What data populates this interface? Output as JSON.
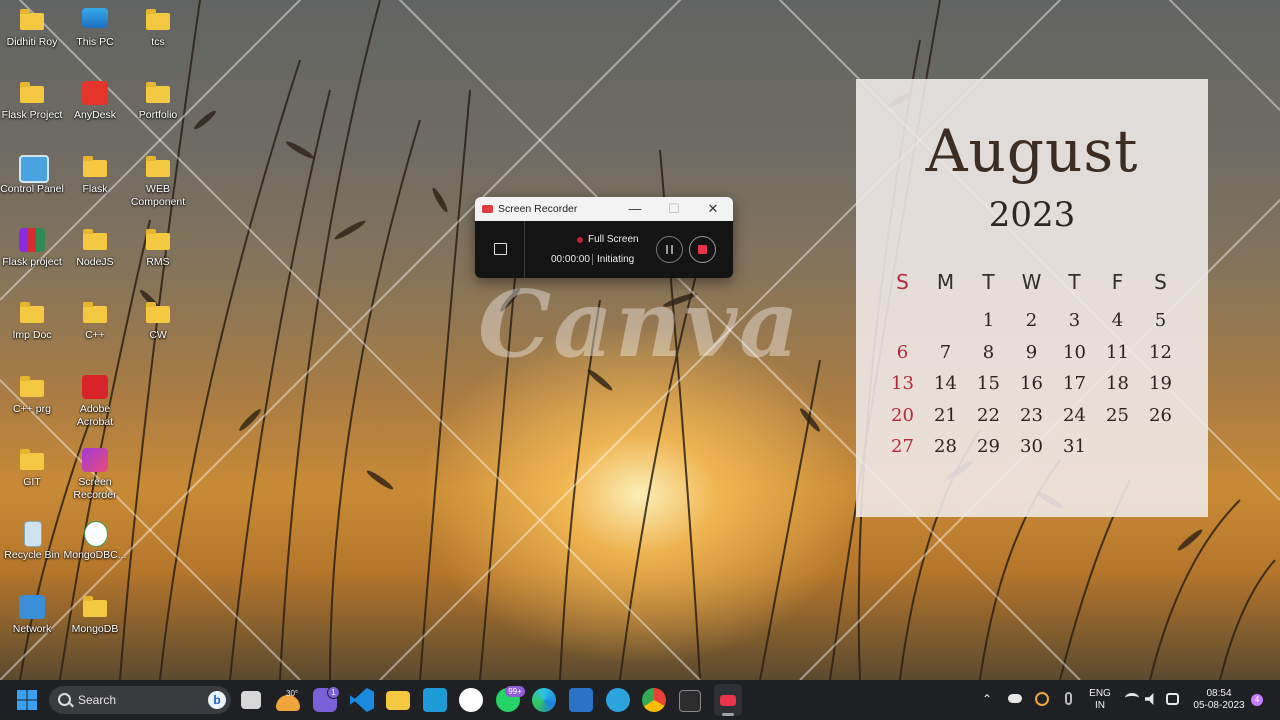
{
  "desktop_icons": [
    {
      "label": "Didhiti Roy",
      "icon": "folder-icon"
    },
    {
      "label": "This PC",
      "icon": "monitor-icon"
    },
    {
      "label": "tcs",
      "icon": "folder-icon"
    },
    {
      "label": "Flask Project",
      "icon": "folder-icon"
    },
    {
      "label": "AnyDesk",
      "icon": "anydesk-icon"
    },
    {
      "label": "Portfolio",
      "icon": "folder-icon"
    },
    {
      "label": "Control Panel",
      "icon": "control-panel-icon"
    },
    {
      "label": "Flask",
      "icon": "folder-icon"
    },
    {
      "label": "WEB",
      "label2": "Component",
      "icon": "folder-icon"
    },
    {
      "label": "Flask project",
      "icon": "winrar-icon"
    },
    {
      "label": "NodeJS",
      "icon": "folder-icon"
    },
    {
      "label": "RMS",
      "icon": "folder-icon"
    },
    {
      "label": "Imp Doc",
      "icon": "folder-icon"
    },
    {
      "label": "C++",
      "icon": "folder-icon"
    },
    {
      "label": "CW",
      "icon": "folder-icon"
    },
    {
      "label": "C++ prg",
      "icon": "folder-icon"
    },
    {
      "label": "Adobe",
      "label2": "Acrobat",
      "icon": "acrobat-icon"
    },
    {
      "label": "GIT",
      "icon": "folder-icon"
    },
    {
      "label": "Screen",
      "label2": "Recorder",
      "icon": "screen-recorder-icon"
    },
    {
      "label": "Recycle Bin",
      "icon": "recycle-bin-icon"
    },
    {
      "label": "MongoDBC...",
      "icon": "mongodb-compass-icon"
    },
    {
      "label": "Network",
      "icon": "network-icon"
    },
    {
      "label": "MongoDB",
      "icon": "folder-icon"
    }
  ],
  "watermark": "Canva",
  "calendar": {
    "month": "August",
    "year": "2023",
    "weekdays": [
      "S",
      "M",
      "T",
      "W",
      "T",
      "F",
      "S"
    ],
    "weeks": [
      [
        "",
        "",
        "1",
        "2",
        "3",
        "4",
        "5"
      ],
      [
        "6",
        "7",
        "8",
        "9",
        "10",
        "11",
        "12"
      ],
      [
        "13",
        "14",
        "15",
        "16",
        "17",
        "18",
        "19"
      ],
      [
        "20",
        "21",
        "22",
        "23",
        "24",
        "25",
        "26"
      ],
      [
        "27",
        "28",
        "29",
        "30",
        "31",
        "",
        ""
      ]
    ],
    "sunday_color": "#b42a3c"
  },
  "recorder": {
    "title": "Screen Recorder",
    "mode": "Full Screen",
    "time": "00:00:00",
    "status": "Initiating",
    "minimize": "—",
    "maximize": "☐",
    "close": "✕"
  },
  "taskbar": {
    "search_label": "Search",
    "bing_letter": "b",
    "weather_temp": "30°",
    "teams_badge": "1",
    "whatsapp_badge": "99+",
    "language_line1": "ENG",
    "language_line2": "IN",
    "time": "08:54",
    "date": "05-08-2023",
    "notification_count": "4",
    "apps": [
      "start-icon",
      "search-input",
      "task-view-icon",
      "widgets-weather-icon",
      "teams-chat-icon",
      "vscode-icon",
      "file-explorer-icon",
      "vmware-icon",
      "word-icon",
      "whatsapp-icon",
      "edge-icon",
      "remote-desktop-icon",
      "telegram-icon",
      "chrome-icon",
      "terminal-icon",
      "screen-recorder-icon"
    ]
  },
  "colors": {
    "taskbar": "#1f2023",
    "accent": "#0078d4",
    "record_red": "#e8334b"
  }
}
